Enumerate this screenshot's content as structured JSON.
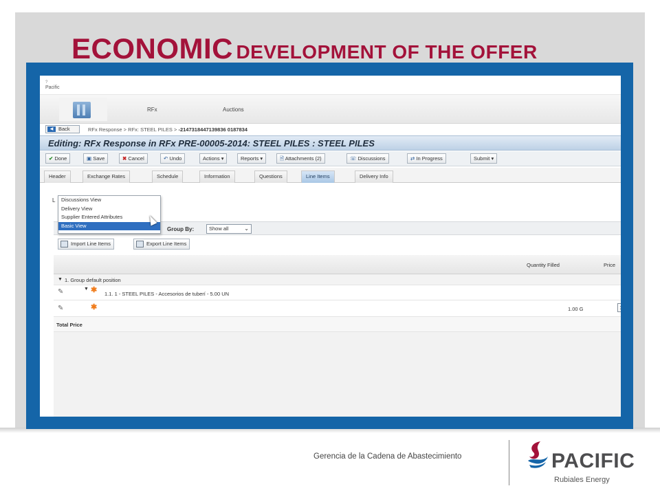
{
  "slide": {
    "title_big": "ECONOMIC",
    "title_rest": "DEVELOPMENT OF THE OFFER",
    "footer_text": "Gerencia de la Cadena de Abastecimiento",
    "brand_name": "PACIFIC",
    "brand_sub": "Rubiales Energy",
    "colors": {
      "title": "#a3123a",
      "frame": "#1565a8",
      "panel": "#d9d9d9"
    }
  },
  "app": {
    "mini_logo": "Pacific",
    "mini_logo_sub": "?",
    "nav_tabs": [
      "RFx",
      "Auctions"
    ],
    "back_label": "Back",
    "breadcrumb": "RFx Response  >  RFx: STEEL PILES  >",
    "breadcrumb_id": "-2147318447139836 0187834",
    "edit_title": "Editing: RFx Response in RFx PRE-00005-2014: STEEL PILES : STEEL PILES",
    "toolbar": {
      "done": "Done",
      "save": "Save",
      "cancel": "Cancel",
      "undo": "Undo",
      "actions": "Actions",
      "reports": "Reports",
      "attachments": "Attachments (2)",
      "discussions": "Discussions",
      "in_progress": "In Progress",
      "submit": "Submit"
    },
    "tabs": [
      "Header",
      "Exchange Rates",
      "Schedule",
      "Information",
      "Questions",
      "Line Items",
      "Delivery Info"
    ],
    "active_tab": "Line Items",
    "view_label": "L",
    "view_options": [
      "Discussions View",
      "Delivery View",
      "Supplier Entered Attributes",
      "Basic View"
    ],
    "selected_view": "Basic View",
    "group_by_label": "Group By:",
    "group_by_value": "Show all",
    "import_label": "Import Line Items",
    "export_label": "Export Line Items",
    "columns": {
      "quantity_filled": "Quantity Filled",
      "price": "Price"
    },
    "group_row": "1. Group default position",
    "line_item": "1.1. 1 - STEEL PILES - Accesorios de tuberí - 5.00 UN",
    "quantity_value": "1.00 G",
    "price_input": "1",
    "total_label": "Total Price"
  }
}
